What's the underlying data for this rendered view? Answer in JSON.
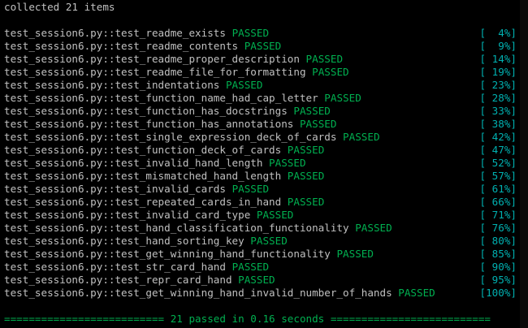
{
  "header": {
    "collected": "collected 21 items"
  },
  "status_word": "PASSED",
  "tests": [
    {
      "name": "test_session6.py::test_readme_exists",
      "pct": "[  4%]"
    },
    {
      "name": "test_session6.py::test_readme_contents",
      "pct": "[  9%]"
    },
    {
      "name": "test_session6.py::test_readme_proper_description",
      "pct": "[ 14%]"
    },
    {
      "name": "test_session6.py::test_readme_file_for_formatting",
      "pct": "[ 19%]"
    },
    {
      "name": "test_session6.py::test_indentations",
      "pct": "[ 23%]"
    },
    {
      "name": "test_session6.py::test_function_name_had_cap_letter",
      "pct": "[ 28%]"
    },
    {
      "name": "test_session6.py::test_function_has_docstrings",
      "pct": "[ 33%]"
    },
    {
      "name": "test_session6.py::test_function_has_annotations",
      "pct": "[ 38%]"
    },
    {
      "name": "test_session6.py::test_single_expression_deck_of_cards",
      "pct": "[ 42%]"
    },
    {
      "name": "test_session6.py::test_function_deck_of_cards",
      "pct": "[ 47%]"
    },
    {
      "name": "test_session6.py::test_invalid_hand_length",
      "pct": "[ 52%]"
    },
    {
      "name": "test_session6.py::test_mismatched_hand_length",
      "pct": "[ 57%]"
    },
    {
      "name": "test_session6.py::test_invalid_cards",
      "pct": "[ 61%]"
    },
    {
      "name": "test_session6.py::test_repeated_cards_in_hand",
      "pct": "[ 66%]"
    },
    {
      "name": "test_session6.py::test_invalid_card_type",
      "pct": "[ 71%]"
    },
    {
      "name": "test_session6.py::test_hand_classification_functionality",
      "pct": "[ 76%]"
    },
    {
      "name": "test_session6.py::test_hand_sorting_key",
      "pct": "[ 80%]"
    },
    {
      "name": "test_session6.py::test_get_winning_hand_functionality",
      "pct": "[ 85%]"
    },
    {
      "name": "test_session6.py::test_str_card_hand",
      "pct": "[ 90%]"
    },
    {
      "name": "test_session6.py::test_repr_card_hand",
      "pct": "[ 95%]"
    },
    {
      "name": "test_session6.py::test_get_winning_hand_invalid_number_of_hands",
      "pct": "[100%]"
    }
  ],
  "summary": "========================== 21 passed in 0.16 seconds ==========================",
  "colors": {
    "background": "#000000",
    "text": "#c0c0c0",
    "passed": "#00b050",
    "percent": "#00b0b0"
  }
}
